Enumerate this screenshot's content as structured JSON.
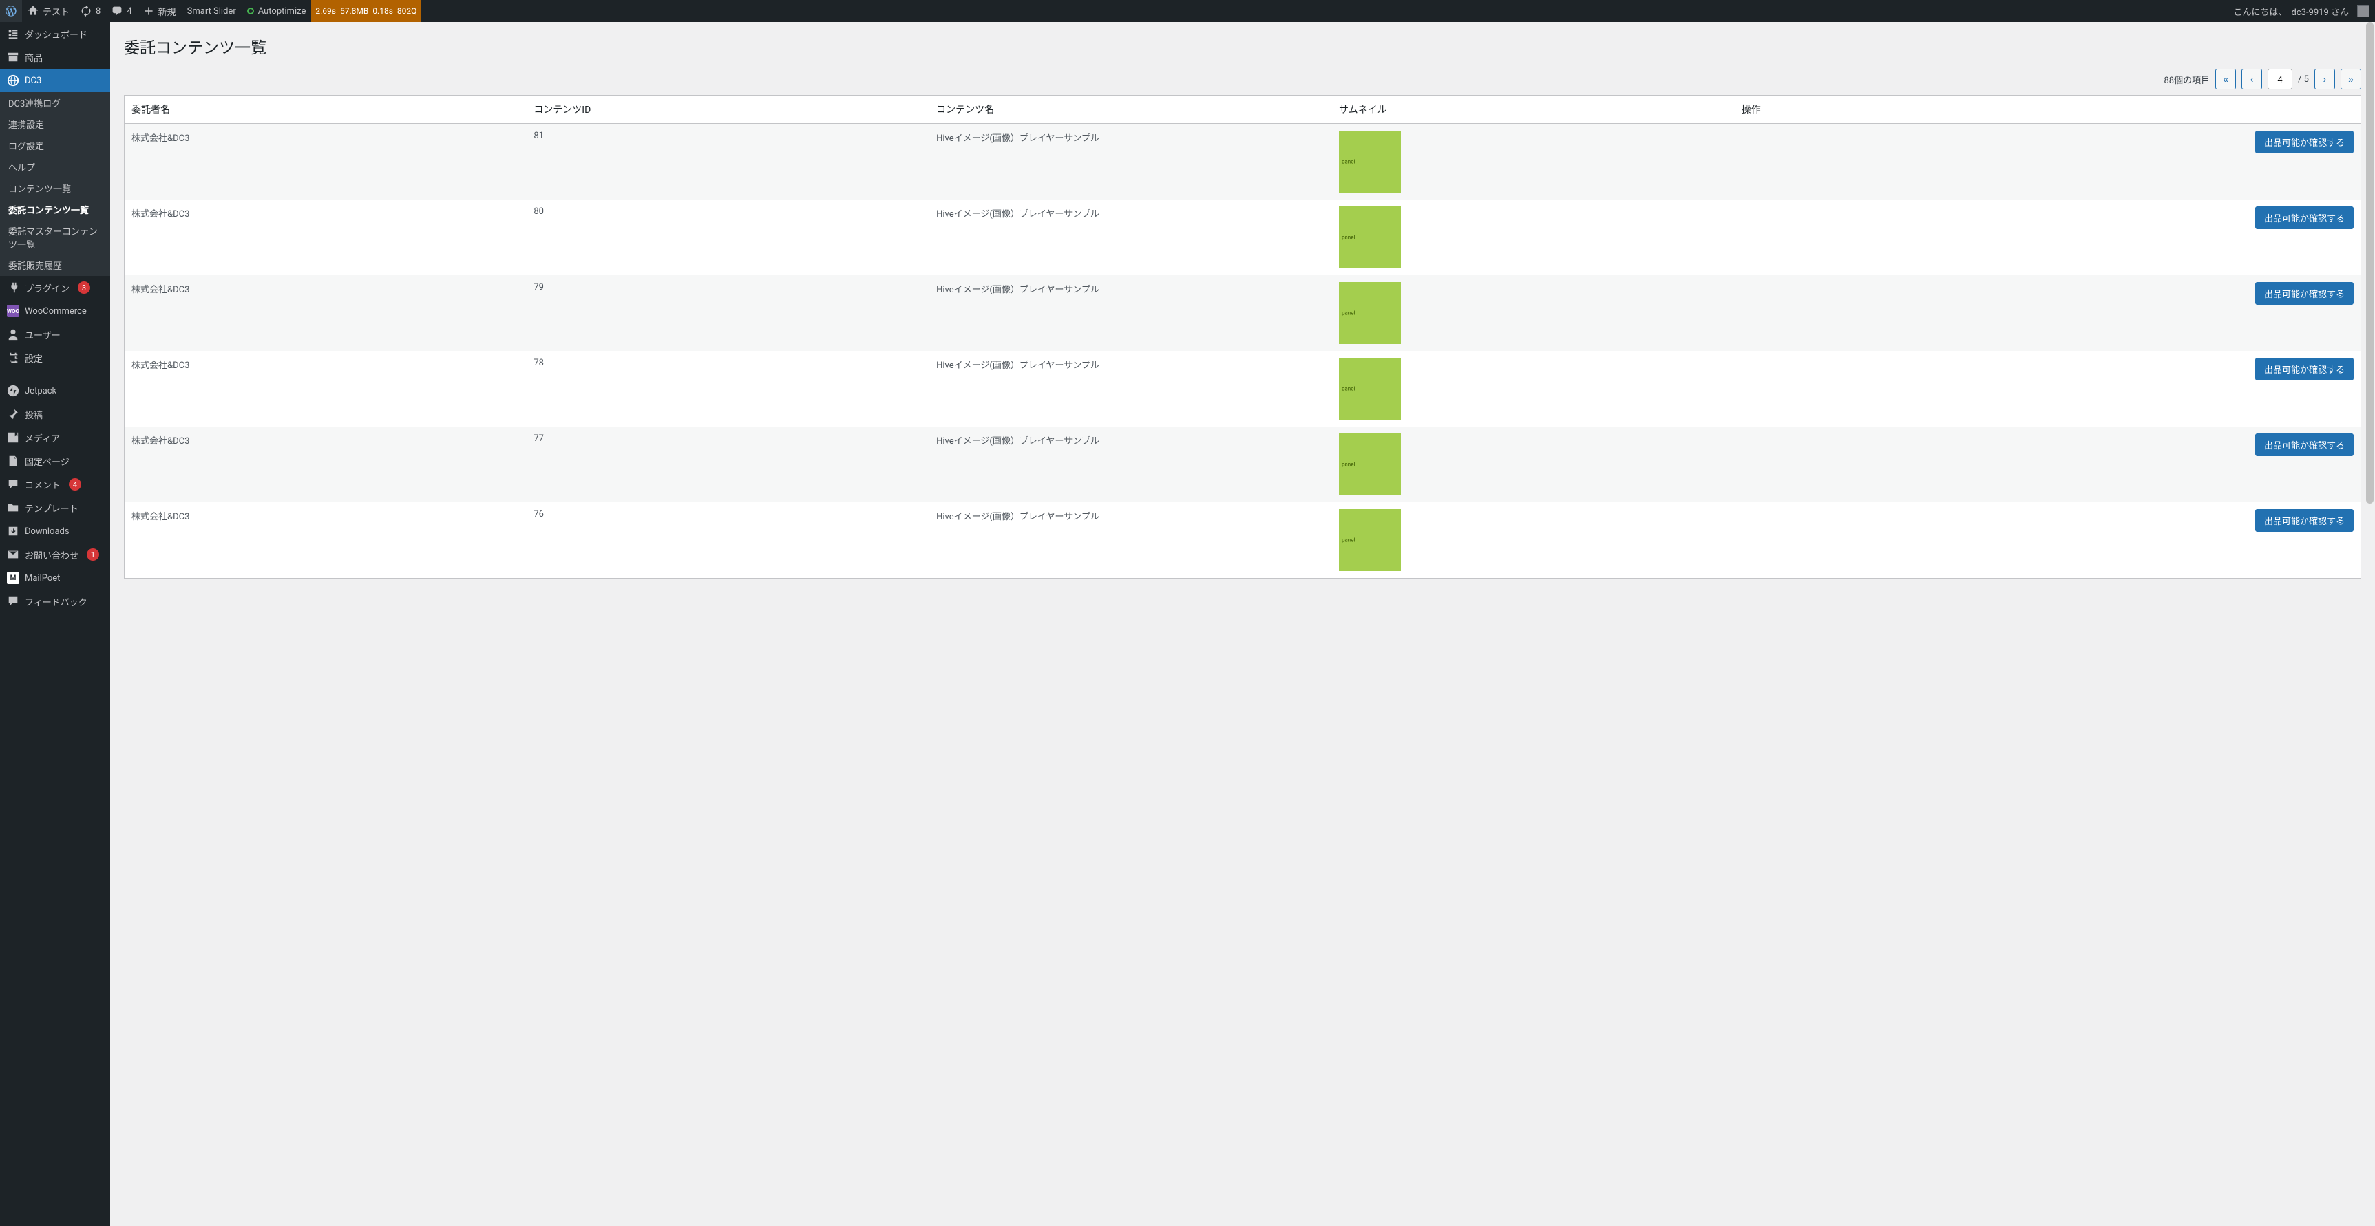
{
  "adminbar": {
    "site_name": "テスト",
    "updates": "8",
    "comments": "4",
    "new_label": "新規",
    "smart_slider": "Smart Slider",
    "autoptimize": "Autoptimize",
    "perf": {
      "time": "2.69s",
      "mem": "57.8MB",
      "ttfb": "0.18s",
      "queries": "802Q"
    },
    "greeting": "こんにちは、",
    "user": "dc3-9919 さん"
  },
  "menu": {
    "dashboard": "ダッシュボード",
    "products": "商品",
    "dc3": "DC3",
    "dc3_sub": {
      "log": "DC3連携ログ",
      "link": "連携設定",
      "logset": "ログ設定",
      "help": "ヘルプ",
      "contents": "コンテンツ一覧",
      "entrusted": "委託コンテンツ一覧",
      "master": "委託マスターコンテンツ一覧",
      "sales": "委託販売履歴"
    },
    "plugins": "プラグイン",
    "plugins_badge": "3",
    "woo": "WooCommerce",
    "users": "ユーザー",
    "settings": "設定",
    "jetpack": "Jetpack",
    "posts": "投稿",
    "media": "メディア",
    "pages": "固定ページ",
    "comments": "コメント",
    "comments_badge": "4",
    "templates": "テンプレート",
    "downloads": "Downloads",
    "contact": "お問い合わせ",
    "contact_badge": "1",
    "mailpoet": "MailPoet",
    "feedback": "フィードバック"
  },
  "page": {
    "title": "委託コンテンツ一覧",
    "item_count": "88個の項目",
    "page_current": "4",
    "page_of": "/ 5"
  },
  "table": {
    "cols": {
      "client": "委託者名",
      "cid": "コンテンツID",
      "cname": "コンテンツ名",
      "thumb": "サムネイル",
      "ops": "操作"
    },
    "op_btn": "出品可能か確認する",
    "thumb_label": "panel",
    "rows": [
      {
        "client": "株式会社&DC3",
        "cid": "81",
        "cname": "Hiveイメージ(画像）プレイヤーサンプル"
      },
      {
        "client": "株式会社&DC3",
        "cid": "80",
        "cname": "Hiveイメージ(画像）プレイヤーサンプル"
      },
      {
        "client": "株式会社&DC3",
        "cid": "79",
        "cname": "Hiveイメージ(画像）プレイヤーサンプル"
      },
      {
        "client": "株式会社&DC3",
        "cid": "78",
        "cname": "Hiveイメージ(画像）プレイヤーサンプル"
      },
      {
        "client": "株式会社&DC3",
        "cid": "77",
        "cname": "Hiveイメージ(画像）プレイヤーサンプル"
      },
      {
        "client": "株式会社&DC3",
        "cid": "76",
        "cname": "Hiveイメージ(画像）プレイヤーサンプル"
      }
    ]
  }
}
